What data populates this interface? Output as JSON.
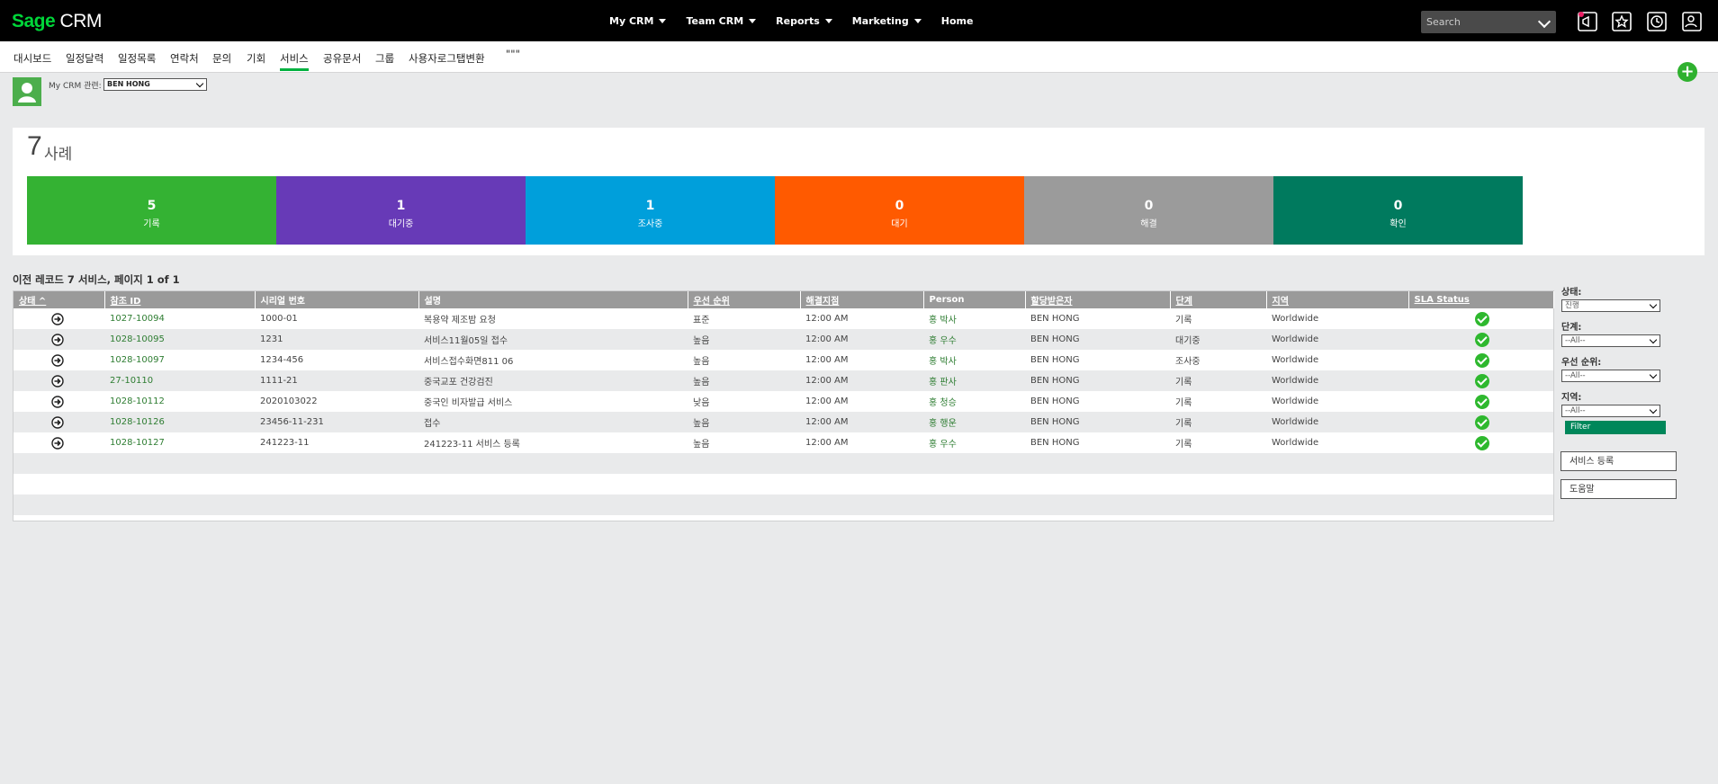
{
  "header": {
    "logo_sage": "Sage",
    "logo_crm": "CRM",
    "nav": [
      {
        "label": "My CRM",
        "has_dropdown": true
      },
      {
        "label": "Team CRM",
        "has_dropdown": true
      },
      {
        "label": "Reports",
        "has_dropdown": true
      },
      {
        "label": "Marketing",
        "has_dropdown": true
      },
      {
        "label": "Home",
        "has_dropdown": false
      }
    ],
    "search_placeholder": "Search",
    "icons": [
      "notification-icon",
      "favorites-icon",
      "recent-icon",
      "user-settings-icon"
    ]
  },
  "tabs": [
    "대시보드",
    "일정달력",
    "일정목록",
    "연락처",
    "문의",
    "기회",
    "서비스",
    "공유문서",
    "그룹",
    "사용자로그탭변환",
    "\"\"\""
  ],
  "active_tab": "서비스",
  "mycrm": {
    "label": "My CRM 관련:",
    "selected": "BEN HONG"
  },
  "cases": {
    "count": "7",
    "label": "사례",
    "tiles": [
      {
        "value": "5",
        "label": "기록",
        "color": "#34b233"
      },
      {
        "value": "1",
        "label": "대기중",
        "color": "#673ab7"
      },
      {
        "value": "1",
        "label": "조사중",
        "color": "#009fdb"
      },
      {
        "value": "0",
        "label": "대기",
        "color": "#ff5a00"
      },
      {
        "value": "0",
        "label": "해결",
        "color": "#9b9b9b"
      },
      {
        "value": "0",
        "label": "확인",
        "color": "#007a5e"
      }
    ]
  },
  "records": {
    "caption": "이전 레코드 7 서비스, 페이지 1 of 1",
    "columns": [
      "상태 ^",
      "참조 ID",
      "시리얼 번호",
      "설명",
      "우선 순위",
      "해결지점",
      "Person",
      "할당받은자",
      "단계",
      "지역",
      "SLA Status"
    ],
    "rows": [
      [
        "1027-10094",
        "1000-01",
        "복용약 제조밤 요청",
        "표준",
        "12:00 AM",
        "홍 박사",
        "BEN HONG",
        "기록",
        "Worldwide"
      ],
      [
        "1028-10095",
        "1231",
        "서비스11월05일 접수",
        "높음",
        "12:00 AM",
        "홍 우수",
        "BEN HONG",
        "대기중",
        "Worldwide"
      ],
      [
        "1028-10097",
        "1234-456",
        "서비스접수화면811 06",
        "높음",
        "12:00 AM",
        "홍 박사",
        "BEN HONG",
        "조사중",
        "Worldwide"
      ],
      [
        "27-10110",
        "1111-21",
        "중국교포 건강검진",
        "높음",
        "12:00 AM",
        "홍 판사",
        "BEN HONG",
        "기록",
        "Worldwide"
      ],
      [
        "1028-10112",
        "2020103022",
        "중국인 비자발급 서비스",
        "낮음",
        "12:00 AM",
        "홍 청승",
        "BEN HONG",
        "기록",
        "Worldwide"
      ],
      [
        "1028-10126",
        "23456-11-231",
        "접수",
        "높음",
        "12:00 AM",
        "홍 행운",
        "BEN HONG",
        "기록",
        "Worldwide"
      ],
      [
        "1028-10127",
        "241223-11",
        "241223-11 서비스 등록",
        "높음",
        "12:00 AM",
        "홍 우수",
        "BEN HONG",
        "기록",
        "Worldwide"
      ]
    ]
  },
  "filters": {
    "status_label": "상태:",
    "status_value": "진행",
    "stage_label": "단계:",
    "stage_value": "--All--",
    "priority_label": "우선 순위:",
    "priority_value": "--All--",
    "region_label": "지역:",
    "region_value": "--All--",
    "filter_button": "Filter"
  },
  "actions": {
    "new_service": "서비스 등록",
    "help": "도움말"
  }
}
